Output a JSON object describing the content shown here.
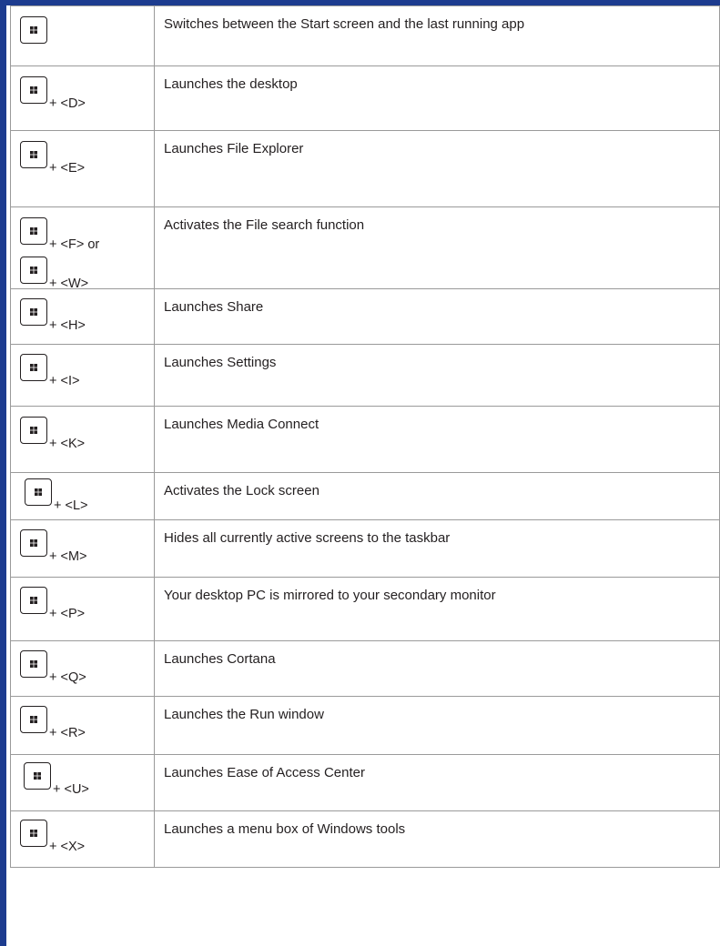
{
  "shortcuts": [
    {
      "keys": [
        ""
      ],
      "description": "Switches between the Start screen and the last running app"
    },
    {
      "keys": [
        "+ <D>"
      ],
      "description": "Launches the desktop"
    },
    {
      "keys": [
        "+ <E>"
      ],
      "description": "Launches File Explorer"
    },
    {
      "keys": [
        "+ <F>  or",
        "+ <W>"
      ],
      "description": "Activates the File search function"
    },
    {
      "keys": [
        "+ <H>"
      ],
      "description": "Launches Share"
    },
    {
      "keys": [
        "+ <I>"
      ],
      "description": "Launches Settings"
    },
    {
      "keys": [
        "+ <K>"
      ],
      "description": "Launches Media Connect"
    },
    {
      "keys": [
        "+ <L>"
      ],
      "description": "Activates the Lock screen"
    },
    {
      "keys": [
        "+ <M>"
      ],
      "description": "Hides all currently active screens to the taskbar"
    },
    {
      "keys": [
        "+ <P>"
      ],
      "description": "Your desktop PC is mirrored to your secondary monitor"
    },
    {
      "keys": [
        "+ <Q>"
      ],
      "description": "Launches Cortana"
    },
    {
      "keys": [
        "+ <R>"
      ],
      "description": "Launches the Run window"
    },
    {
      "keys": [
        "+ <U>"
      ],
      "description": "Launches Ease of Access Center"
    },
    {
      "keys": [
        "+ <X>"
      ],
      "description": "Launches a menu box of Windows tools"
    }
  ],
  "key_icon": "windows-logo-icon",
  "colors": {
    "accent_bar": "#1d3c8f",
    "border": "#9a9a9a",
    "text": "#231f20"
  }
}
